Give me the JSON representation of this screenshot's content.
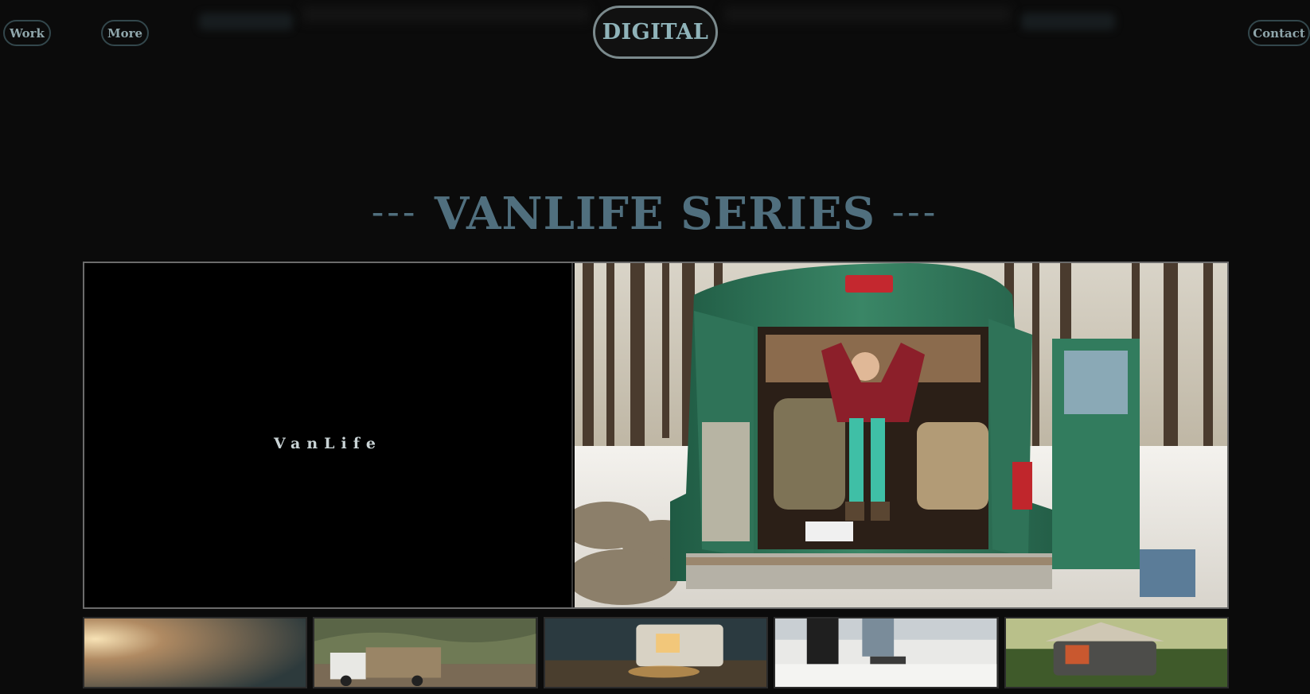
{
  "nav": {
    "work_label": "Work",
    "more_label": "More",
    "brand": "DIGITAL",
    "contact_label": "Contact"
  },
  "section": {
    "dashes_left": "---",
    "title": "VANLIFE SERIES",
    "dashes_right": "---"
  },
  "gallery": {
    "caption": "VanLife",
    "hero_image": "person-in-green-van-photo"
  },
  "thumbnails": [
    {
      "name": "sunset-haze-thumb"
    },
    {
      "name": "white-truck-hills-thumb"
    },
    {
      "name": "camper-trailer-night-thumb"
    },
    {
      "name": "couple-on-van-thumb"
    },
    {
      "name": "rooftop-tent-car-thumb"
    }
  ],
  "colors": {
    "background": "#0b0b0b",
    "title": "#506f7e",
    "brand_text": "#8fb3b9",
    "van_green": "#2f7358"
  }
}
